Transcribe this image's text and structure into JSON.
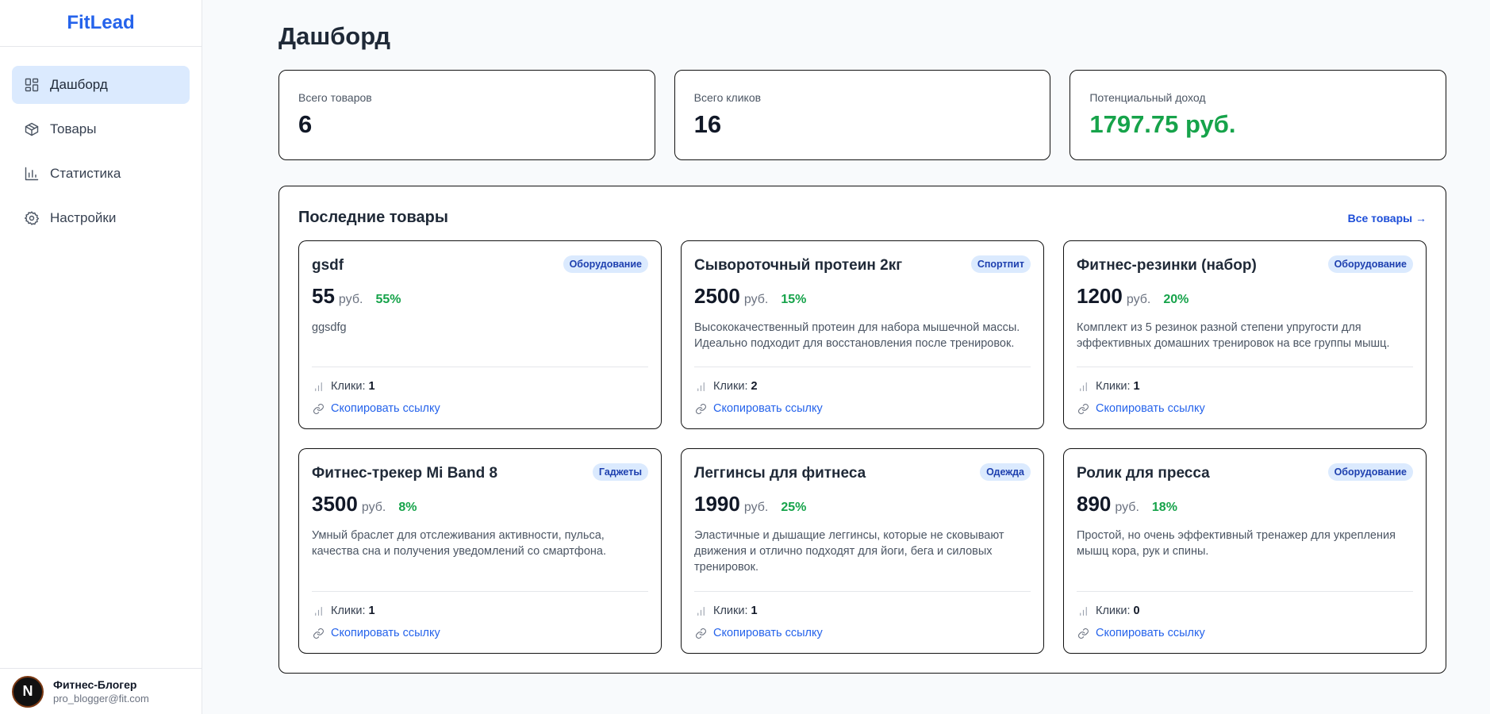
{
  "app": {
    "brand": "FitLead"
  },
  "sidebar": {
    "items": [
      {
        "label": "Дашборд",
        "icon": "dashboard-icon",
        "active": true
      },
      {
        "label": "Товары",
        "icon": "box-icon",
        "active": false
      },
      {
        "label": "Статистика",
        "icon": "bar-chart-icon",
        "active": false
      },
      {
        "label": "Настройки",
        "icon": "gear-icon",
        "active": false
      }
    ]
  },
  "user": {
    "initial": "N",
    "name": "Фитнес-Блогер",
    "email": "pro_blogger@fit.com"
  },
  "page": {
    "title": "Дашборд"
  },
  "stats": [
    {
      "label": "Всего товаров",
      "value": "6"
    },
    {
      "label": "Всего кликов",
      "value": "16"
    },
    {
      "label": "Потенциальный доход",
      "value": "1797.75 руб."
    }
  ],
  "recent": {
    "title": "Последние товары",
    "all_link": "Все товары →",
    "clicks_label": "Клики:",
    "copy_label": "Скопировать ссылку",
    "currency": "руб.",
    "products": [
      {
        "title": "gsdf",
        "badge": "Оборудование",
        "price": "55",
        "percent": "55%",
        "description": "ggsdfg",
        "clicks": "1"
      },
      {
        "title": "Сывороточный протеин 2кг",
        "badge": "Спортпит",
        "price": "2500",
        "percent": "15%",
        "description": "Высококачественный протеин для набора мышечной массы. Идеально подходит для восстановления после тренировок.",
        "clicks": "2"
      },
      {
        "title": "Фитнес-резинки (набор)",
        "badge": "Оборудование",
        "price": "1200",
        "percent": "20%",
        "description": "Комплект из 5 резинок разной степени упругости для эффективных домашних тренировок на все группы мышц.",
        "clicks": "1"
      },
      {
        "title": "Фитнес-трекер Mi Band 8",
        "badge": "Гаджеты",
        "price": "3500",
        "percent": "8%",
        "description": "Умный браслет для отслеживания активности, пульса, качества сна и получения уведомлений со смартфона.",
        "clicks": "1"
      },
      {
        "title": "Леггинсы для фитнеса",
        "badge": "Одежда",
        "price": "1990",
        "percent": "25%",
        "description": "Эластичные и дышащие леггинсы, которые не сковывают движения и отлично подходят для йоги, бега и силовых тренировок.",
        "clicks": "1"
      },
      {
        "title": "Ролик для пресса",
        "badge": "Оборудование",
        "price": "890",
        "percent": "18%",
        "description": "Простой, но очень эффективный тренажер для укрепления мышц кора, рук и спины.",
        "clicks": "0"
      }
    ]
  },
  "colors": {
    "brand": "#2563eb",
    "active_bg": "#dbeafe",
    "positive": "#16a34a",
    "badge_text": "#1e40af"
  }
}
